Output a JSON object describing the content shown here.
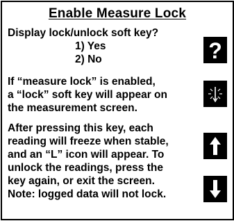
{
  "screen": {
    "title": "Enable Measure Lock",
    "prompt": {
      "question": "Display lock/unlock soft key?",
      "option_1": "1) Yes",
      "option_2": "2) No"
    },
    "info_1": {
      "line_1": "If “measure lock” is enabled,",
      "line_2": "a “lock” soft key will appear on",
      "line_3": "the measurement screen."
    },
    "info_2": {
      "line_1": "After pressing this key, each",
      "line_2": "reading will freeze when stable,",
      "line_3": "and an “L” icon will appear.  To",
      "line_4": "unlock the readings, press the",
      "line_5": "key again, or exit the screen.",
      "line_6": "Note: logged data will not lock."
    }
  },
  "softkeys": [
    {
      "name": "help",
      "icon": "question-mark-icon",
      "glyph": "?"
    },
    {
      "name": "select",
      "icon": "select-press-icon"
    },
    {
      "name": "up",
      "icon": "arrow-up-icon"
    },
    {
      "name": "down",
      "icon": "arrow-down-icon"
    }
  ],
  "colors": {
    "background": "#ffffff",
    "foreground": "#000000",
    "softkey_bg": "#000000",
    "softkey_fg": "#ffffff"
  }
}
